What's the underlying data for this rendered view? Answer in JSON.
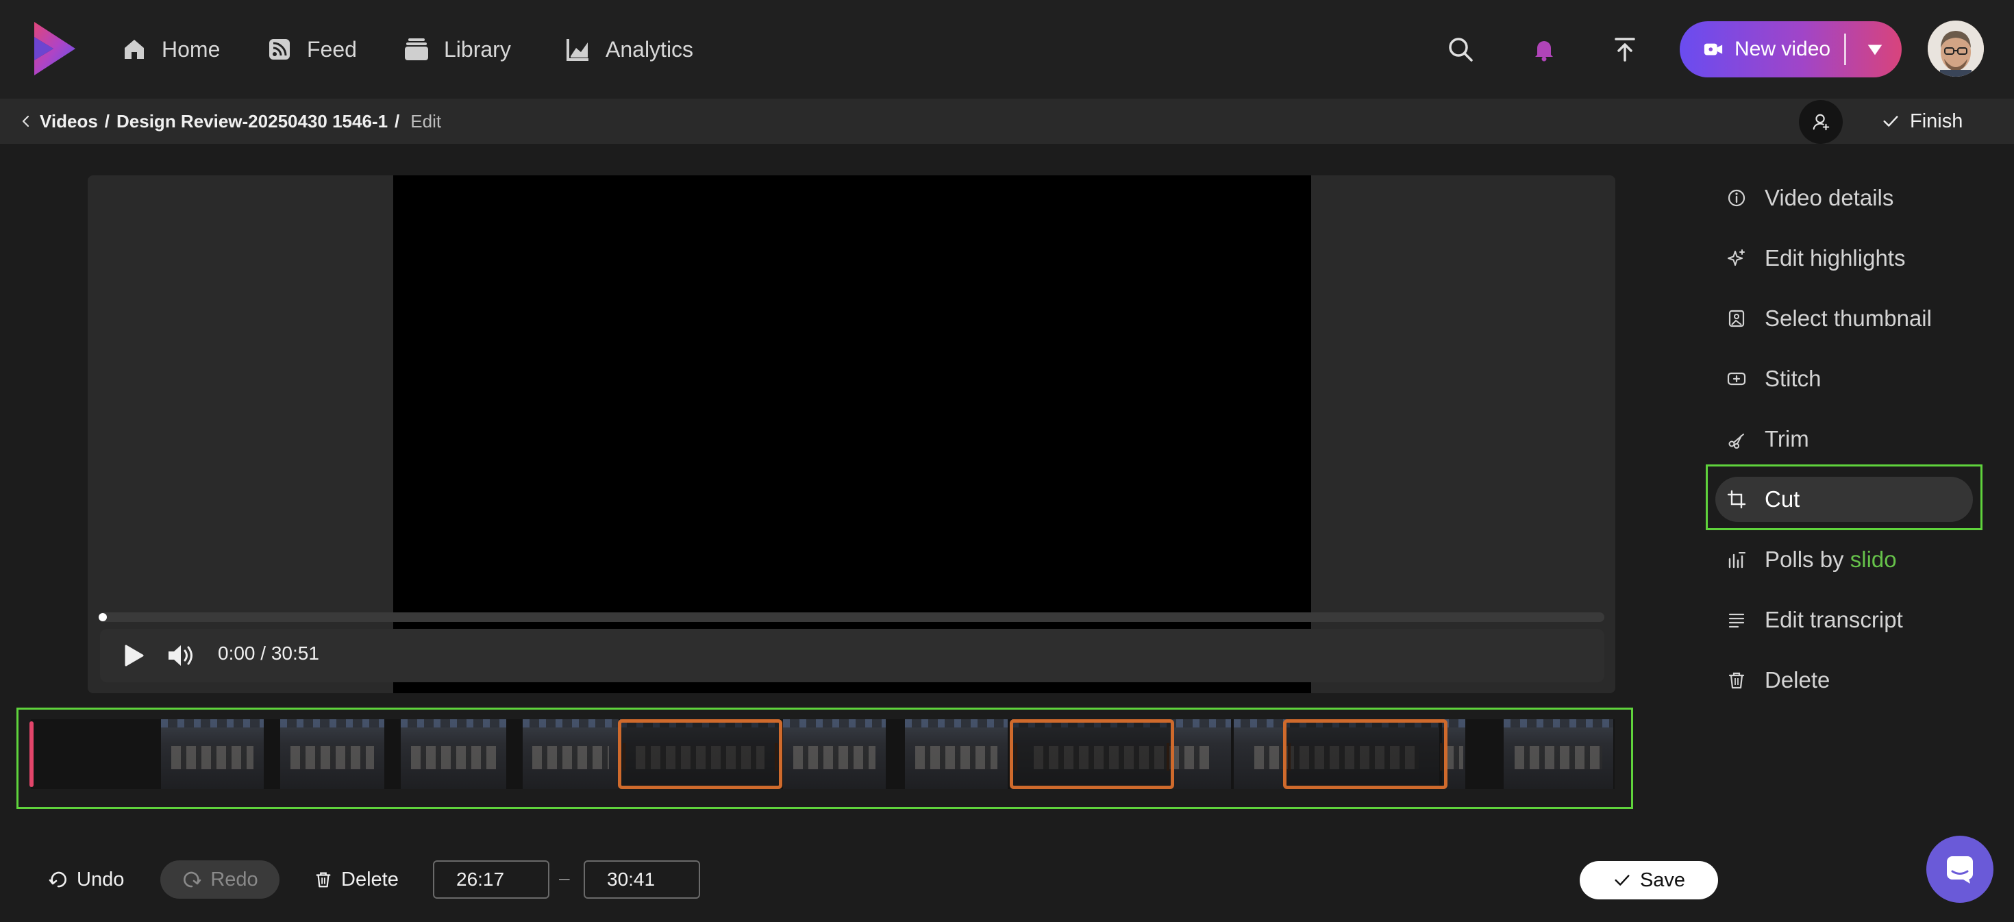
{
  "colors": {
    "accent_gradient": [
      "#6a4cf0",
      "#a045c8",
      "#d8447c"
    ],
    "highlight_frame": "#5fd33c",
    "cut_segment": "#cf6a2c",
    "playhead": "#e2456a",
    "slido": "#66c24a",
    "bell": "#b044b8"
  },
  "nav": {
    "items": [
      {
        "label": "Home",
        "icon": "home-icon"
      },
      {
        "label": "Feed",
        "icon": "feed-icon"
      },
      {
        "label": "Library",
        "icon": "library-icon"
      },
      {
        "label": "Analytics",
        "icon": "analytics-icon"
      }
    ],
    "new_video_label": "New video"
  },
  "breadcrumb": {
    "videos": "Videos",
    "sep1": "/",
    "title": "Design Review-20250430 1546-1",
    "sep2": "/",
    "current": "Edit"
  },
  "header_actions": {
    "finish_label": "Finish"
  },
  "player": {
    "time": "0:00 / 30:51",
    "progress": 0
  },
  "timeline": {
    "cut_segments": 3
  },
  "sidebar_menu": {
    "items": [
      {
        "label": "Video details",
        "icon": "info-icon"
      },
      {
        "label": "Edit highlights",
        "icon": "sparkle-icon"
      },
      {
        "label": "Select thumbnail",
        "icon": "image-icon"
      },
      {
        "label": "Stitch",
        "icon": "stitch-icon"
      },
      {
        "label": "Trim",
        "icon": "scissors-icon"
      },
      {
        "label": "Cut",
        "icon": "crop-icon",
        "active": true
      },
      {
        "label": "Polls by",
        "label_brand": "slido",
        "icon": "polls-icon"
      },
      {
        "label": "Edit transcript",
        "icon": "transcript-icon"
      },
      {
        "label": "Delete",
        "icon": "trash-icon"
      }
    ]
  },
  "toolbar": {
    "undo_label": "Undo",
    "redo_label": "Redo",
    "delete_label": "Delete",
    "start_time": "26:17",
    "dash": "–",
    "end_time": "30:41",
    "save_label": "Save"
  }
}
